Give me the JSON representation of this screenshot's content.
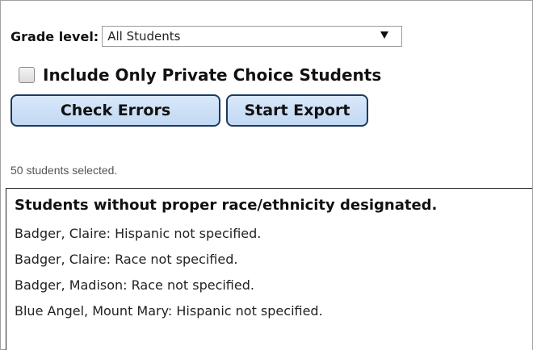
{
  "filters": {
    "grade_label": "Grade level:",
    "grade_value": "All Students",
    "private_choice_label": "Include Only Private Choice Students",
    "private_choice_checked": false
  },
  "actions": {
    "check_errors_label": "Check Errors",
    "start_export_label": "Start Export"
  },
  "status": {
    "selected_text": "50 students selected."
  },
  "errors": {
    "title": "Students without proper race/ethnicity designated.",
    "items": [
      "Badger, Claire: Hispanic not specified.",
      "Badger, Claire: Race not specified.",
      "Badger, Madison: Race not specified.",
      "Blue Angel, Mount Mary: Hispanic not specified."
    ]
  },
  "icons": {
    "dropdown": "dropdown-arrow-icon"
  },
  "colors": {
    "button_fill": "#c9ddf5",
    "button_border": "#1c3a5e"
  }
}
